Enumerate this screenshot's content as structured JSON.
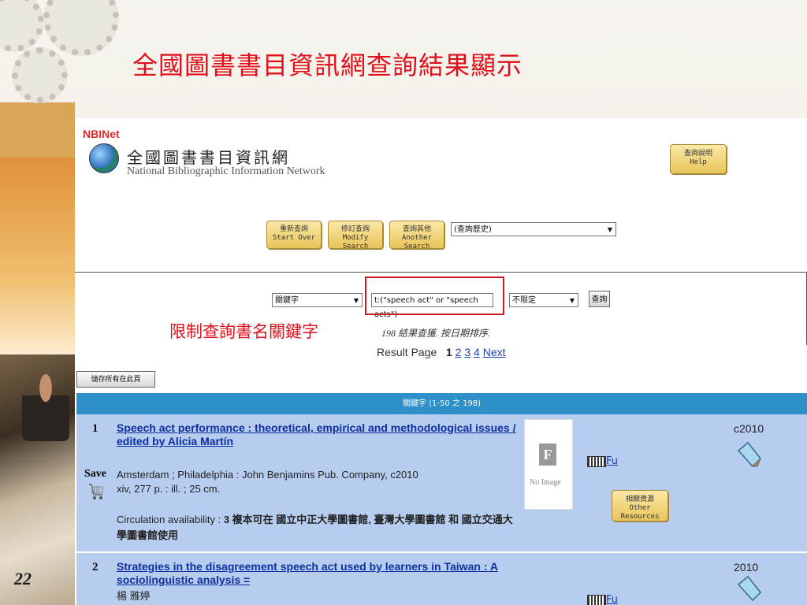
{
  "slide": {
    "title": "全國圖書書目資訊網查詢結果顯示",
    "number": "22",
    "annotation": "限制查詢書名關鍵字",
    "accent_color": "#e0101b"
  },
  "site": {
    "logo_letters": "NBINet",
    "title_zh": "全國圖書書目資訊網",
    "title_en": "National Bibliographic Information Network",
    "help_zh": "查詢說明",
    "help_en": "Help"
  },
  "toolbar": {
    "start_zh": "重新查詢",
    "start_en": "Start Over",
    "modify_zh": "修訂查詢",
    "modify_en": "Modify Search",
    "another_zh": "查詢其他",
    "another_en": "Another Search",
    "history_value": "(查詢歷史)"
  },
  "search": {
    "field_value": "關鍵字",
    "query_value": "t:(\"speech act\" or \"speech acts\")",
    "limit_value": "不限定",
    "submit_label": "查詢"
  },
  "results": {
    "summary": "198 結果查獲. 按日期排序.",
    "page_label": "Result Page",
    "current_page": "1",
    "pages": [
      "2",
      "3",
      "4"
    ],
    "next_label": "Next",
    "save_all_label": "儲存所有在此頁",
    "header": "關鍵字 (1-50 之 198)",
    "header_color": "#2f8fc8",
    "row_color": "#b7cdf0",
    "items": [
      {
        "num": "1",
        "title": "Speech act performance : theoretical, empirical and methodological issues / edited by Alicia Martín",
        "save_label": "Save",
        "pub": "Amsterdam ; Philadelphia : John Benjamins Pub. Company, c2010",
        "extent": "xiv, 277 p. : ill. ; 25 cm.",
        "circ_label": "Circulation availability : ",
        "circ_value": "3 複本可在 國立中正大學圖書館, 臺灣大學圖書館 和 國立交通大學圖書館使用",
        "noimage_letter": "F",
        "noimage_text": "No Image",
        "fulltext_label": "Fu",
        "other_zh": "相關資源",
        "other_en": "Other Resources",
        "year": "c2010"
      },
      {
        "num": "2",
        "title": "Strategies in the disagreement speech act used by learners in Taiwan : A sociolinguistic analysis =",
        "author": "楊 雅婷",
        "fulltext_label": "Fu",
        "year": "2010"
      }
    ]
  }
}
